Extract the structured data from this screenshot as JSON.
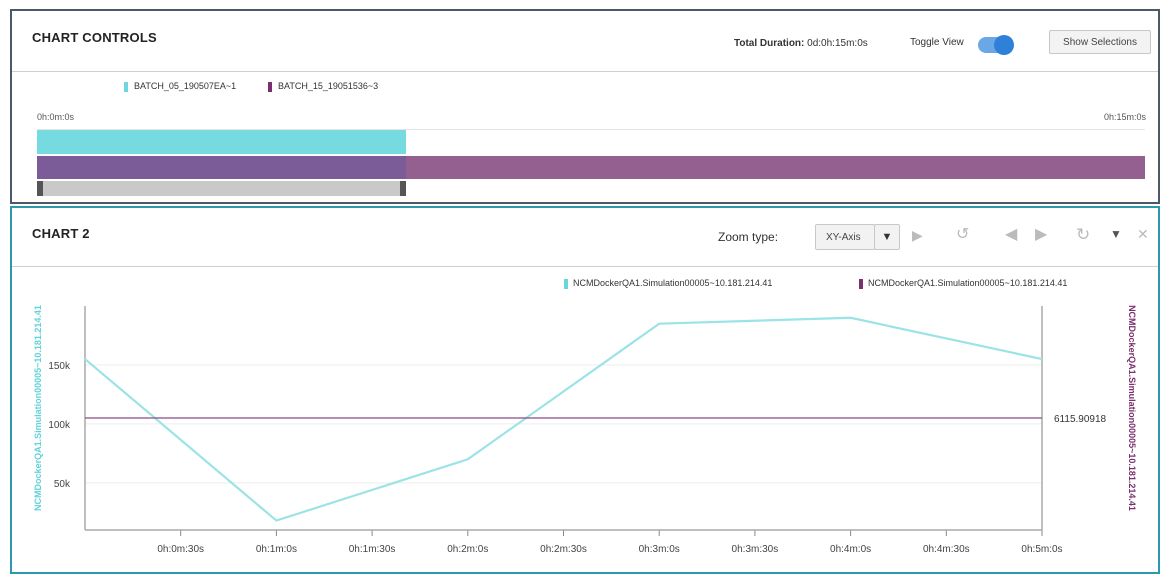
{
  "panel1": {
    "title": "CHART CONTROLS",
    "total_duration_label": "Total Duration:",
    "total_duration_value": "0d:0h:15m:0s",
    "toggle_view_label": "Toggle View",
    "toggle_on": true,
    "show_selections_label": "Show Selections",
    "legend": [
      {
        "label": "BATCH_05_190507EA~1",
        "color": "#6fd6dc"
      },
      {
        "label": "BATCH_15_19051536~3",
        "color": "#7a2f6e"
      }
    ],
    "timeline_start": "0h:0m:0s",
    "timeline_end": "0h:15m:0s",
    "bar1_fraction": 0.333,
    "bar2_fraction": 1.0,
    "selection_fraction": 0.333
  },
  "panel2": {
    "title": "CHART 2",
    "zoom_type_label": "Zoom type:",
    "zoom_type_value": "XY-Axis",
    "icons": [
      "play-icon",
      "undo-icon",
      "prev-icon",
      "next-icon",
      "history-icon",
      "chevron-down-icon",
      "close-icon"
    ],
    "legend": [
      {
        "label": "NCMDockerQA1.Simulation00005~10.181.214.41",
        "color": "#66d8dc"
      },
      {
        "label": "NCMDockerQA1.Simulation00005~10.181.214.41",
        "color": "#7a2f6e"
      }
    ],
    "y_left_label": "NCMDockerQA1.Simulation00005~10.181.214.41",
    "y_right_label": "NCMDockerQA1.Simulation00005~10.181.214.41",
    "right_value_label": "6115.90918"
  },
  "chart_data": {
    "type": "line",
    "x_ticks": [
      "0h:0m:30s",
      "0h:1m:0s",
      "0h:1m:30s",
      "0h:2m:0s",
      "0h:2m:30s",
      "0h:3m:0s",
      "0h:3m:30s",
      "0h:4m:0s",
      "0h:4m:30s",
      "0h:5m:0s"
    ],
    "y_ticks": [
      "150k",
      "100k",
      "50k"
    ],
    "xlim": [
      0,
      300
    ],
    "ylim": [
      10000,
      200000
    ],
    "grid": true,
    "series": [
      {
        "name": "NCMDockerQA1.Simulation00005~10.181.214.41",
        "axis": "left",
        "color": "#9be3e6",
        "x": [
          0,
          60,
          120,
          180,
          240,
          300
        ],
        "y": [
          155000,
          18000,
          70000,
          185000,
          190000,
          155000
        ]
      },
      {
        "name": "NCMDockerQA1.Simulation00005~10.181.214.41",
        "axis": "right",
        "color": "#8a4a82",
        "x": [
          0,
          300
        ],
        "y": [
          6115.90918,
          6115.90918
        ]
      }
    ]
  }
}
